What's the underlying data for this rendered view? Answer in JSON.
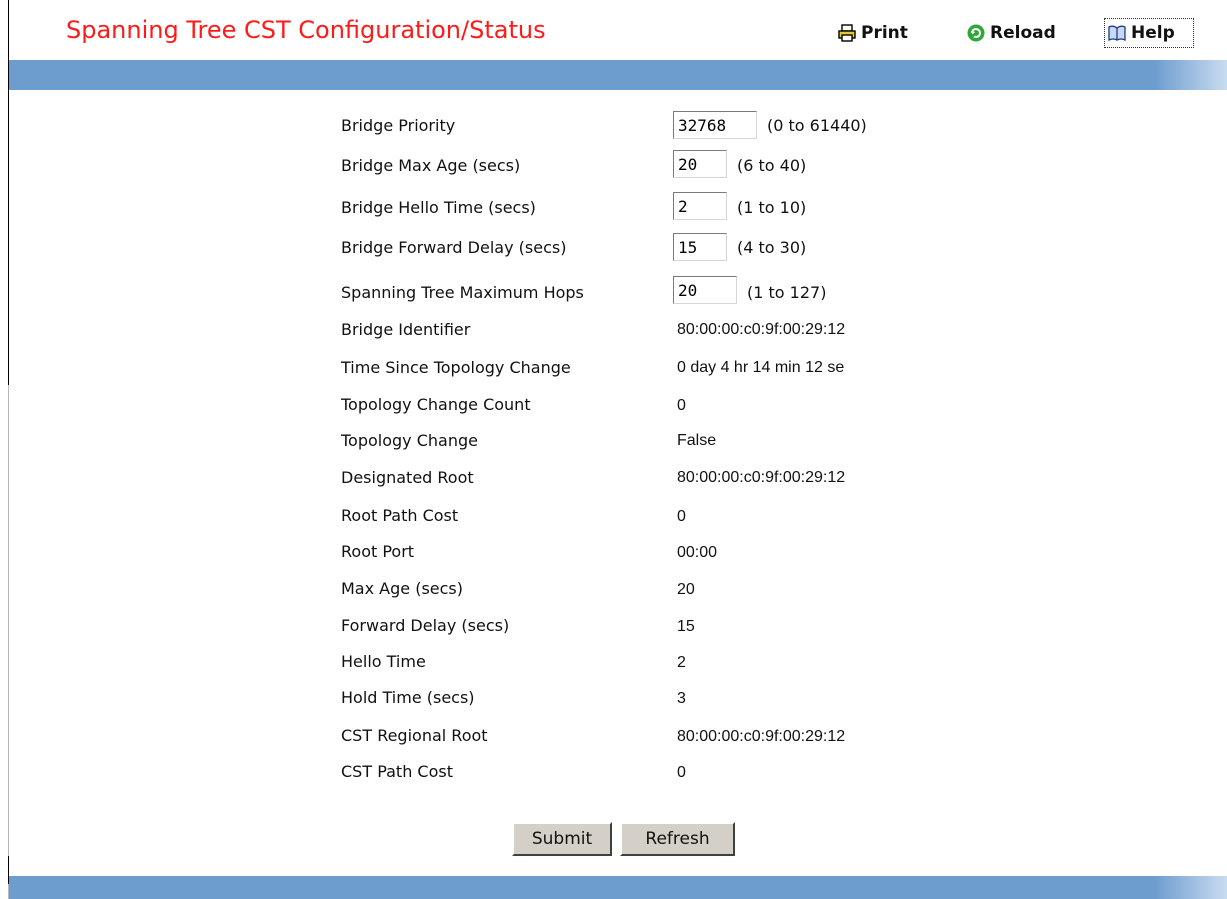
{
  "page": {
    "title": "Spanning Tree CST Configuration/Status"
  },
  "toolbar": {
    "print_label": "Print",
    "reload_label": "Reload",
    "help_label": "Help"
  },
  "config": {
    "bridge_priority": {
      "label": "Bridge Priority",
      "value": "32768",
      "range": "(0 to 61440)"
    },
    "bridge_max_age": {
      "label": "Bridge Max Age (secs)",
      "value": "20",
      "range": "(6 to 40)"
    },
    "bridge_hello_time": {
      "label": "Bridge Hello Time (secs)",
      "value": "2",
      "range": "(1 to 10)"
    },
    "bridge_forward_delay": {
      "label": "Bridge Forward Delay (secs)",
      "value": "15",
      "range": "(4 to 30)"
    },
    "max_hops": {
      "label": "Spanning Tree Maximum Hops",
      "value": "20",
      "range": "(1 to 127)"
    }
  },
  "status": [
    {
      "label": "Bridge Identifier",
      "value": "80:00:00:c0:9f:00:29:12"
    },
    {
      "label": "Time Since Topology Change",
      "value": "0 day 4 hr 14 min 12 se"
    },
    {
      "label": "Topology Change Count",
      "value": "0"
    },
    {
      "label": "Topology Change",
      "value": "False"
    },
    {
      "label": "Designated Root",
      "value": "80:00:00:c0:9f:00:29:12"
    },
    {
      "label": "Root Path Cost",
      "value": "0"
    },
    {
      "label": "Root Port",
      "value": "00:00"
    },
    {
      "label": "Max Age (secs)",
      "value": "20"
    },
    {
      "label": "Forward Delay (secs)",
      "value": "15"
    },
    {
      "label": "Hello Time",
      "value": "2"
    },
    {
      "label": "Hold Time (secs)",
      "value": "3"
    },
    {
      "label": "CST Regional Root",
      "value": "80:00:00:c0:9f:00:29:12"
    },
    {
      "label": "CST Path Cost",
      "value": "0"
    }
  ],
  "buttons": {
    "submit_label": "Submit",
    "refresh_label": "Refresh"
  },
  "colors": {
    "title": "#ff1a1a",
    "bar": "#6d9ccf"
  }
}
